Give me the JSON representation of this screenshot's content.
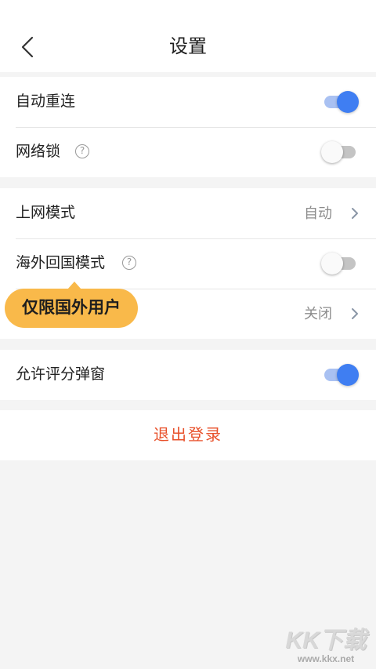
{
  "header": {
    "title": "设置",
    "back_icon": "chevron-left-icon"
  },
  "groups": [
    {
      "items": [
        {
          "label": "自动重连",
          "control": "toggle",
          "on": true
        },
        {
          "label": "网络锁",
          "control": "toggle",
          "on": false,
          "help": true
        }
      ]
    },
    {
      "items": [
        {
          "label": "上网模式",
          "control": "value",
          "value": "自动"
        },
        {
          "label": "海外回国模式",
          "control": "toggle",
          "on": false,
          "help": true
        },
        {
          "label": "",
          "control": "value",
          "value": "关闭"
        }
      ]
    },
    {
      "items": [
        {
          "label": "允许评分弹窗",
          "control": "toggle",
          "on": true
        }
      ]
    }
  ],
  "tooltip": {
    "text": "仅限国外用户"
  },
  "logout": {
    "label": "退出登录"
  },
  "watermark": {
    "logo": "KK下载",
    "url": "www.kkx.net"
  },
  "colors": {
    "accent": "#3f7ef2",
    "accent_track": "#a9c1f2",
    "logout_text": "#e8512b",
    "tooltip_bg": "#f9b94a",
    "background": "#f4f4f4"
  }
}
